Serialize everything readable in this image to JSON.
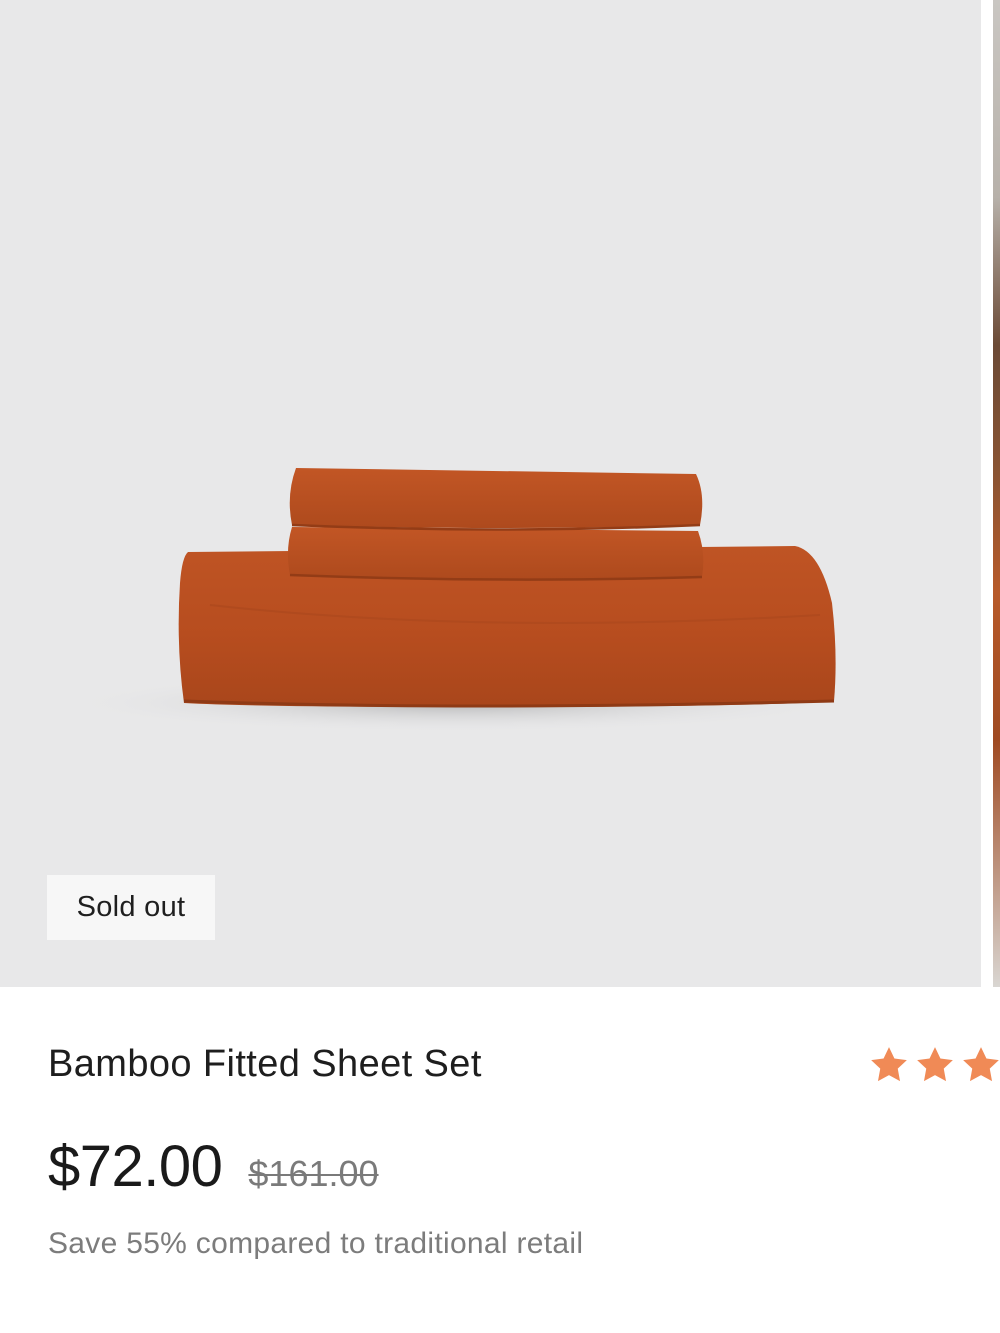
{
  "product": {
    "badge": "Sold out",
    "title": "Bamboo Fitted Sheet Set",
    "price": "$72.00",
    "compare_at_price": "$161.00",
    "savings_note": "Save 55% compared to traditional retail",
    "image_subject": "folded-orange-sheet-set",
    "color": "#b84e20"
  },
  "rating": {
    "star_icon": "star-icon",
    "star_color": "#f08a56"
  }
}
